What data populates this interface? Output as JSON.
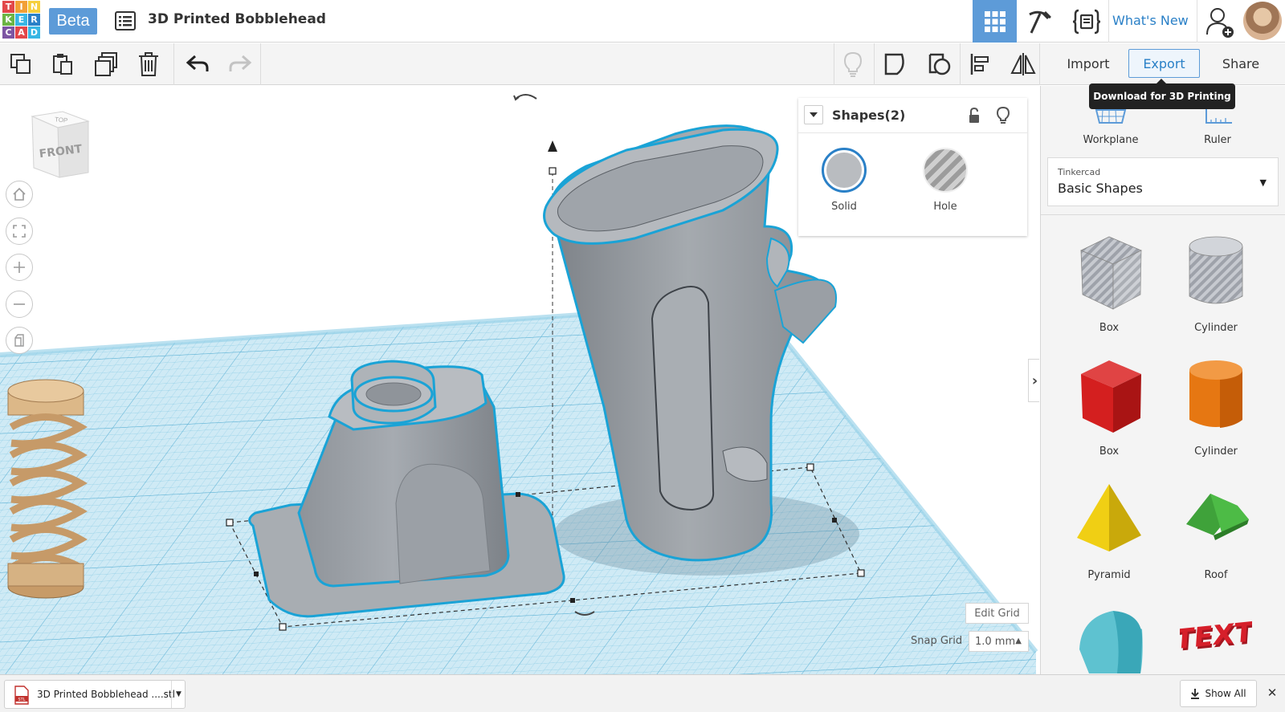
{
  "app": {
    "logo_letters": [
      "T",
      "I",
      "N",
      "K",
      "E",
      "R",
      "C",
      "A",
      "D"
    ],
    "logo_colors": [
      "#e2474a",
      "#f2a036",
      "#f6cf3c",
      "#6cb544",
      "#38b6e4",
      "#2a80c7",
      "#7d55a3",
      "#e2474a",
      "#38b6e4"
    ],
    "beta_label": "Beta",
    "design_title": "3D Printed Bobblehead",
    "whats_new_label": "What's New",
    "accent_color": "#5d9bd8"
  },
  "topbar": {
    "icons": [
      "design-menu-icon",
      "grid-view-icon",
      "pickaxe-icon",
      "code-blocks-icon",
      "add-user-icon",
      "avatar"
    ]
  },
  "toolbar": {
    "import_label": "Import",
    "export_label": "Export",
    "share_label": "Share",
    "export_tooltip": "Download for 3D Printing"
  },
  "viewcube": {
    "top_label": "TOP",
    "front_label": "FRONT"
  },
  "inspector": {
    "title": "Shapes(2)",
    "solid_label": "Solid",
    "hole_label": "Hole"
  },
  "grid": {
    "edit_grid_label": "Edit Grid",
    "snap_grid_label": "Snap Grid",
    "snap_value": "1.0 mm"
  },
  "right_panel": {
    "workplane_label": "Workplane",
    "ruler_label": "Ruler",
    "library_source": "Tinkercad",
    "library_name": "Basic Shapes",
    "shapes": [
      {
        "label": "Box",
        "color": "#b8bcc4"
      },
      {
        "label": "Cylinder",
        "color": "#b8bcc4"
      },
      {
        "label": "Box",
        "color": "#d41f1f"
      },
      {
        "label": "Cylinder",
        "color": "#e67712"
      },
      {
        "label": "Pyramid",
        "color": "#f0cf14"
      },
      {
        "label": "Roof",
        "color": "#3fa23a"
      },
      {
        "label": "",
        "color": "#5ec2d0"
      },
      {
        "label": "",
        "color": "#d61f2a"
      }
    ]
  },
  "download_bar": {
    "file_name": "3D Printed Bobblehead ....stl",
    "show_all_label": "Show All"
  }
}
